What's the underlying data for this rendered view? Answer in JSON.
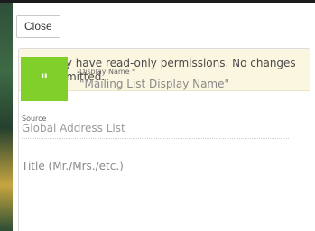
{
  "toolbar": {
    "close_label": "Close"
  },
  "notice": {
    "text": "You only have read-only permissions. No changes are permitted."
  },
  "contact": {
    "avatar_text": "\"",
    "avatar_color": "#80cf2b",
    "display_name_label": "Display Name *",
    "display_name_value": "\"Mailing List Display Name\"",
    "source_label": "Source",
    "source_value": "Global Address List",
    "title_placeholder": "Title (Mr./Mrs./etc.)"
  },
  "colors": {
    "notice_bg": "#fbf6e0",
    "avatar_bg": "#80cf2b"
  }
}
